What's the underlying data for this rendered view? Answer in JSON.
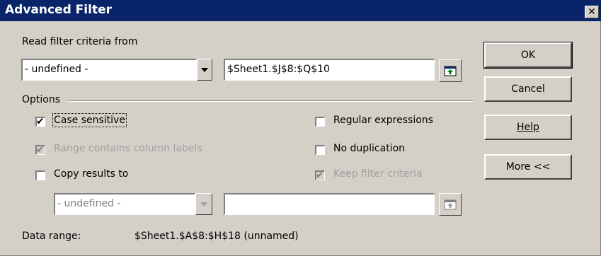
{
  "window": {
    "title": "Advanced Filter",
    "close_glyph": "✕"
  },
  "criteria": {
    "label": "Read filter criteria from",
    "dropdown_value": "- undefined -",
    "range_value": "$Sheet1.$J$8:$Q$10"
  },
  "options": {
    "label": "Options",
    "case_sensitive": {
      "label": "Case sensitive",
      "checked": true
    },
    "range_contains_labels": {
      "label": "Range contains column labels",
      "checked": true,
      "enabled": false
    },
    "copy_results_to": {
      "label": "Copy results to",
      "checked": false
    },
    "regular_expressions": {
      "label": "Regular expressions",
      "checked": false
    },
    "no_duplication": {
      "label": "No duplication",
      "checked": false
    },
    "keep_filter_criteria": {
      "label": "Keep filter criteria",
      "checked": true,
      "enabled": false
    },
    "copy_dropdown_value": "- undefined -",
    "copy_range_value": ""
  },
  "data_range": {
    "label": "Data range:",
    "value": "$Sheet1.$A$8:$H$18 (unnamed)"
  },
  "buttons": {
    "ok": "OK",
    "cancel": "Cancel",
    "help": "Help",
    "more": "More <<"
  },
  "check_glyph": "✔"
}
